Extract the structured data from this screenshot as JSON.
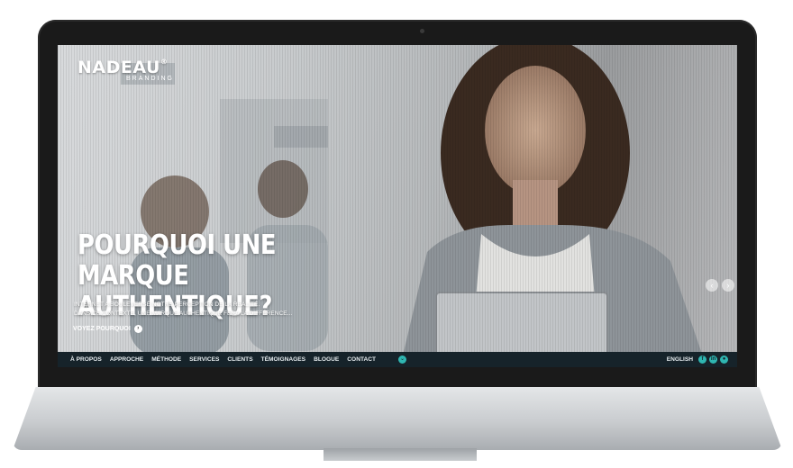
{
  "logo": {
    "name": "NADEAU",
    "mark": "®",
    "sub": "BRANDING"
  },
  "hero": {
    "title_line1": "POURQUOI UNE MARQUE",
    "title_line2": "AUTHENTIQUE?",
    "desc_line1": "INTERNET A BOULEVERSÉ NOTRE PERCEPTION DE LA RÉALITÉ.",
    "desc_line2": "DANS CE CONTEXTE, UNE MARQUE AUTHENTIQUE FERA LA DIFFÉRENCE...",
    "cta": "VOYEZ POURQUOI"
  },
  "nav": {
    "items": [
      "À PROPOS",
      "APPROCHE",
      "MÉTHODE",
      "SERVICES",
      "CLIENTS",
      "TÉMOIGNAGES",
      "BLOGUE",
      "CONTACT"
    ],
    "language": "ENGLISH"
  },
  "icons": {
    "cta": "chevron-right-circle-icon",
    "down": "chevron-down-circle-icon",
    "prev": "chevron-left-icon",
    "next": "chevron-right-icon",
    "social": [
      "facebook-icon",
      "linkedin-icon",
      "rss-icon"
    ]
  },
  "colors": {
    "navbar": "#16232a",
    "accent": "#2fb6b1"
  }
}
